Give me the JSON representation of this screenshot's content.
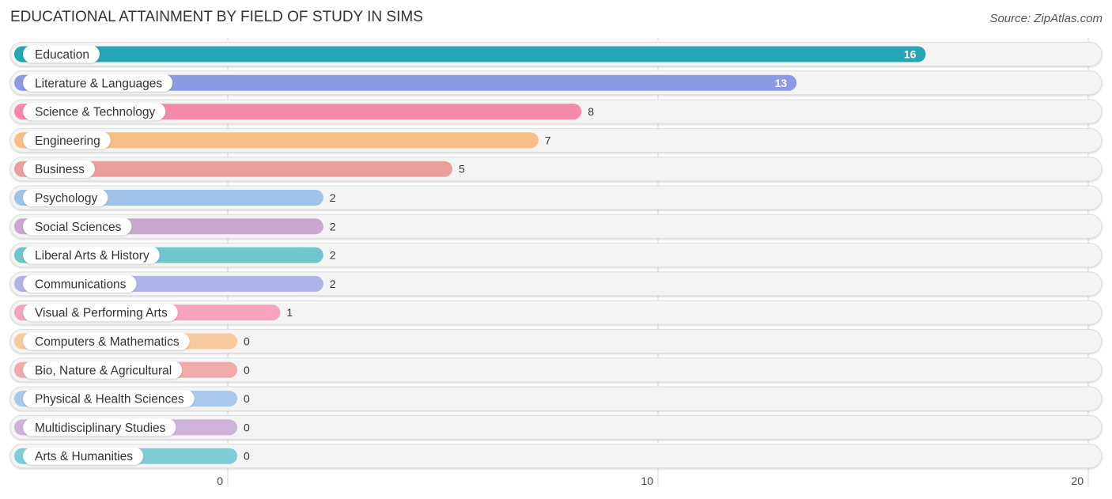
{
  "header": {
    "title": "EDUCATIONAL ATTAINMENT BY FIELD OF STUDY IN SIMS",
    "source": "Source: ZipAtlas.com"
  },
  "chart_data": {
    "type": "bar",
    "orientation": "horizontal",
    "title": "EDUCATIONAL ATTAINMENT BY FIELD OF STUDY IN SIMS",
    "xlabel": "",
    "ylabel": "",
    "xlim": [
      0,
      20
    ],
    "xticks": [
      "0",
      "10",
      "20"
    ],
    "xtick_values": [
      0,
      10,
      20
    ],
    "grid": true,
    "categories": [
      "Education",
      "Literature & Languages",
      "Science & Technology",
      "Engineering",
      "Business",
      "Psychology",
      "Social Sciences",
      "Liberal Arts & History",
      "Communications",
      "Visual & Performing Arts",
      "Computers & Mathematics",
      "Bio, Nature & Agricultural",
      "Physical & Health Sciences",
      "Multidisciplinary Studies",
      "Arts & Humanities"
    ],
    "values": [
      16,
      13,
      8,
      7,
      5,
      2,
      2,
      2,
      2,
      1,
      0,
      0,
      0,
      0,
      0
    ],
    "value_labels": [
      "16",
      "13",
      "8",
      "7",
      "5",
      "2",
      "2",
      "2",
      "2",
      "1",
      "0",
      "0",
      "0",
      "0",
      "0"
    ],
    "colors": [
      "#26a5b6",
      "#8b9ae2",
      "#f689a9",
      "#f9be85",
      "#eb9e9c",
      "#9fc2e8",
      "#c9a7cf",
      "#6ec7cb",
      "#aeb4e8",
      "#f6a3bd",
      "#f9c99e",
      "#f0aaaa",
      "#a9c8ee",
      "#cfb2d8",
      "#7fcdd6"
    ]
  }
}
